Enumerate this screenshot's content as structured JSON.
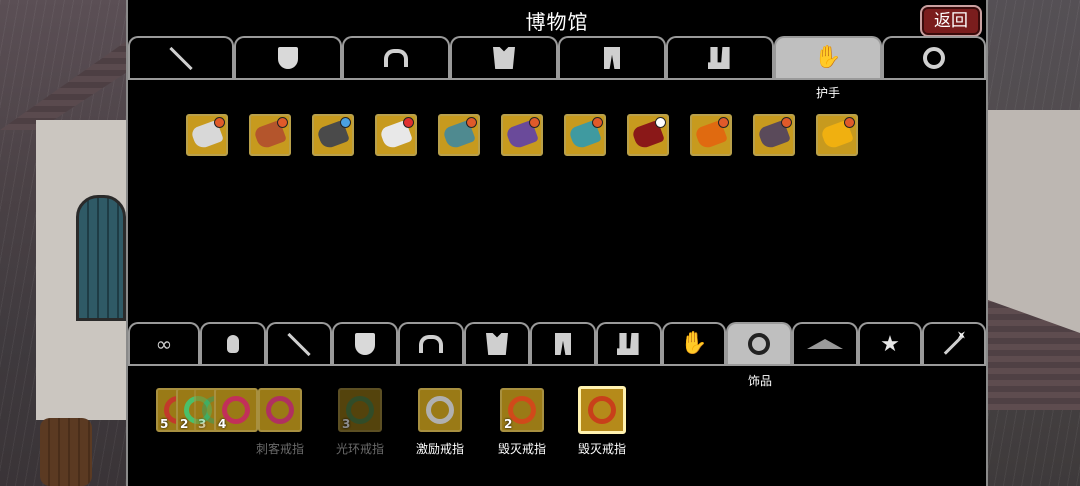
{
  "header": {
    "title": "博物馆",
    "back_label": "返回"
  },
  "top_tabs": [
    {
      "icon": "sword-icon"
    },
    {
      "icon": "shield-icon"
    },
    {
      "icon": "helmet-icon"
    },
    {
      "icon": "armor-icon"
    },
    {
      "icon": "pants-icon"
    },
    {
      "icon": "boots-icon"
    },
    {
      "icon": "glove-icon",
      "active": true
    },
    {
      "icon": "ring-icon"
    }
  ],
  "top_tab_caption": "护手",
  "gauntlets": [
    {
      "color": "#d8d8d8",
      "gem": "#e05a2a"
    },
    {
      "color": "#b4552c",
      "gem": "#e05a2a"
    },
    {
      "color": "#4a4a4a",
      "gem": "#4aa0e0"
    },
    {
      "color": "#e8e8e8",
      "gem": "#e03030"
    },
    {
      "color": "#4f8a90",
      "gem": "#e05a2a"
    },
    {
      "color": "#6a4a9a",
      "gem": "#e05a2a"
    },
    {
      "color": "#3f9aa0",
      "gem": "#e05a2a"
    },
    {
      "color": "#8a1818",
      "gem": "#ffffff"
    },
    {
      "color": "#e06a10",
      "gem": "#e05a2a"
    },
    {
      "color": "#5a4a5a",
      "gem": "#e05a2a"
    },
    {
      "color": "#f0b010",
      "gem": "#e05a2a"
    }
  ],
  "bottom_tabs": [
    {
      "icon": "infinity-icon"
    },
    {
      "icon": "potion-icon"
    },
    {
      "icon": "sword-icon"
    },
    {
      "icon": "shield-icon"
    },
    {
      "icon": "helmet-icon"
    },
    {
      "icon": "armor-icon"
    },
    {
      "icon": "pants-icon"
    },
    {
      "icon": "boots-icon"
    },
    {
      "icon": "glove-icon"
    },
    {
      "icon": "ring-icon",
      "active": true
    },
    {
      "icon": "hat-icon"
    },
    {
      "icon": "star-icon"
    },
    {
      "icon": "wand-icon"
    }
  ],
  "bottom_tab_caption": "饰品",
  "rings": {
    "group1": {
      "label": "刺客戒指",
      "counts": [
        "5",
        "2",
        "3",
        "4"
      ]
    },
    "group2": {
      "label": "光环戒指",
      "count": "3"
    },
    "group3": {
      "label": "激励戒指"
    },
    "group4": {
      "label": "毁灭戒指",
      "count": "2"
    },
    "group5": {
      "label": "毁灭戒指"
    }
  }
}
